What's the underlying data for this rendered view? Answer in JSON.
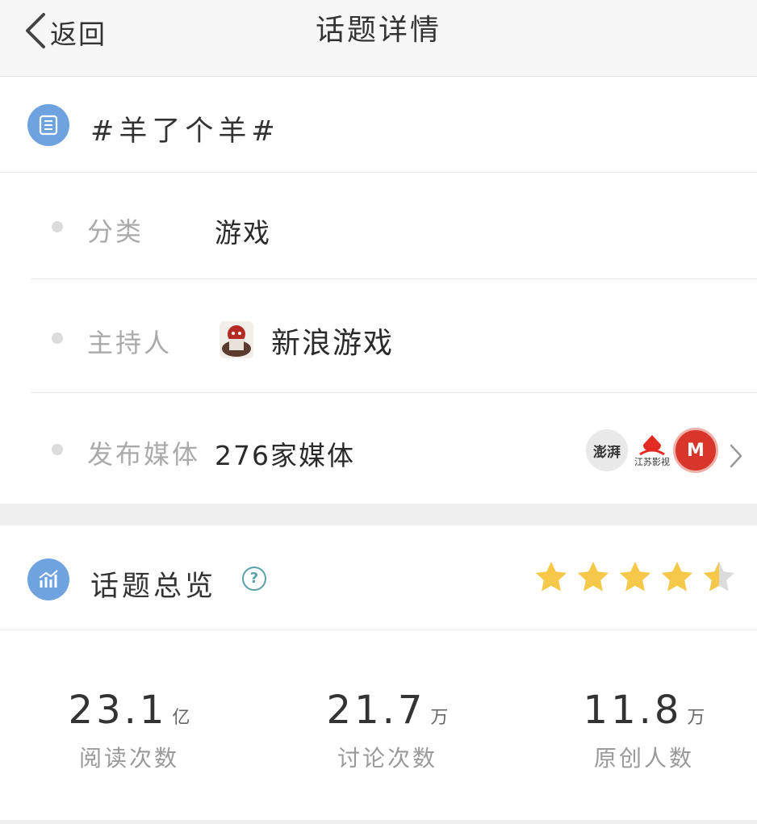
{
  "header": {
    "back_label": "返回",
    "title": "话题详情"
  },
  "topic": {
    "name": "#羊了个羊#"
  },
  "info": {
    "category_label": "分类",
    "category_value": "游戏",
    "host_label": "主持人",
    "host_value": "新浪游戏",
    "media_label": "发布媒体",
    "media_value": "276家媒体",
    "media_logos": [
      {
        "text": "澎湃",
        "color": "#e9e9e9"
      },
      {
        "text": "江苏影视",
        "color": "#ffffff"
      },
      {
        "text": "M",
        "color": "#d9362b"
      }
    ]
  },
  "overview": {
    "title": "话题总览",
    "help_symbol": "?",
    "rating": 4.5,
    "star_color": "#f5c84a",
    "stats": [
      {
        "value": "23.1",
        "unit": "亿",
        "label": "阅读次数"
      },
      {
        "value": "21.7",
        "unit": "万",
        "label": "讨论次数"
      },
      {
        "value": "11.8",
        "unit": "万",
        "label": "原创人数"
      }
    ]
  }
}
